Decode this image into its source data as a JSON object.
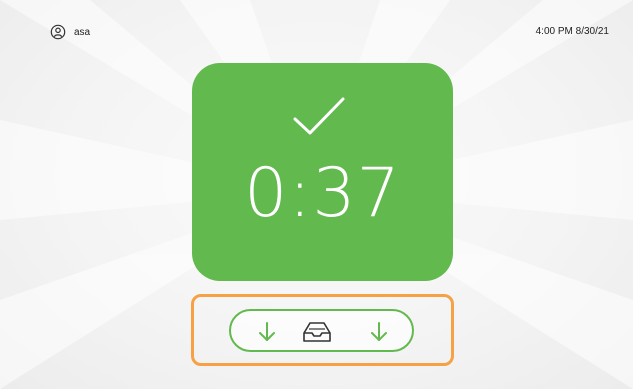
{
  "header": {
    "user_name": "asa",
    "datetime": "4:00 PM 8/30/21"
  },
  "status": {
    "timer": "0:37",
    "state": "success"
  },
  "tray": {
    "icons": [
      "arrow-down-icon",
      "tray-icon",
      "arrow-down-icon"
    ]
  },
  "colors": {
    "success_green": "#62b94e",
    "highlight_orange": "#f6a146",
    "background": "#f4f4f4"
  }
}
